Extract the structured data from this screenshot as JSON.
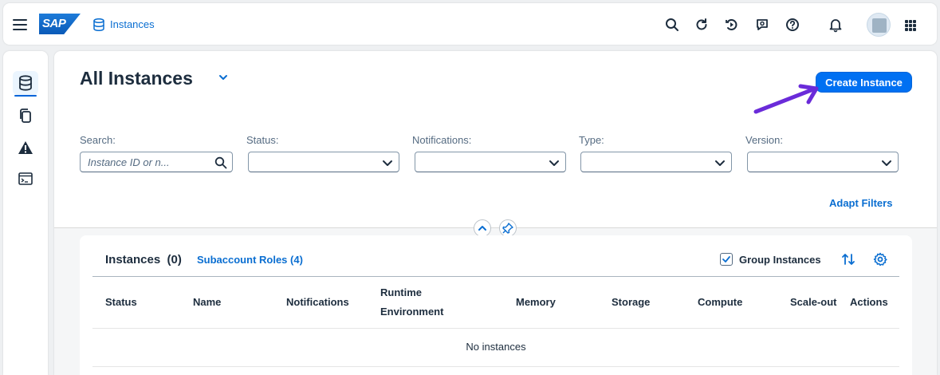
{
  "shell": {
    "logo_text": "SAP",
    "app_title": "Instances",
    "icons": [
      "search-icon",
      "refresh-icon",
      "whats-new-icon",
      "feedback-icon",
      "help-icon",
      "notifications-icon",
      "avatar",
      "product-switch-icon"
    ]
  },
  "sidenav": {
    "items": [
      {
        "name": "instances",
        "icon": "database-icon",
        "active": true
      },
      {
        "name": "copies",
        "icon": "copy-icon",
        "active": false
      },
      {
        "name": "alerts",
        "icon": "warning-icon",
        "active": false
      },
      {
        "name": "console",
        "icon": "terminal-icon",
        "active": false
      }
    ]
  },
  "page": {
    "title": "All Instances",
    "create_button": "Create Instance"
  },
  "filters": {
    "search_label": "Search:",
    "search_placeholder": "Instance ID or n...",
    "status_label": "Status:",
    "notifications_label": "Notifications:",
    "type_label": "Type:",
    "version_label": "Version:",
    "adapt_filters": "Adapt Filters"
  },
  "table": {
    "title": "Instances",
    "count": "(0)",
    "subaccount_roles": "Subaccount Roles (4)",
    "group_instances": "Group Instances",
    "group_checked": true,
    "columns": {
      "status": "Status",
      "name": "Name",
      "notifications": "Notifications",
      "runtime_1": "Runtime",
      "runtime_2": "Environment",
      "memory": "Memory",
      "storage": "Storage",
      "compute": "Compute",
      "scaleout": "Scale-out",
      "actions": "Actions"
    },
    "no_data": "No instances"
  },
  "colors": {
    "accent": "#0070f2",
    "link": "#0a6ed1",
    "arrow": "#6a2bd9",
    "text": "#1d2d3e"
  }
}
